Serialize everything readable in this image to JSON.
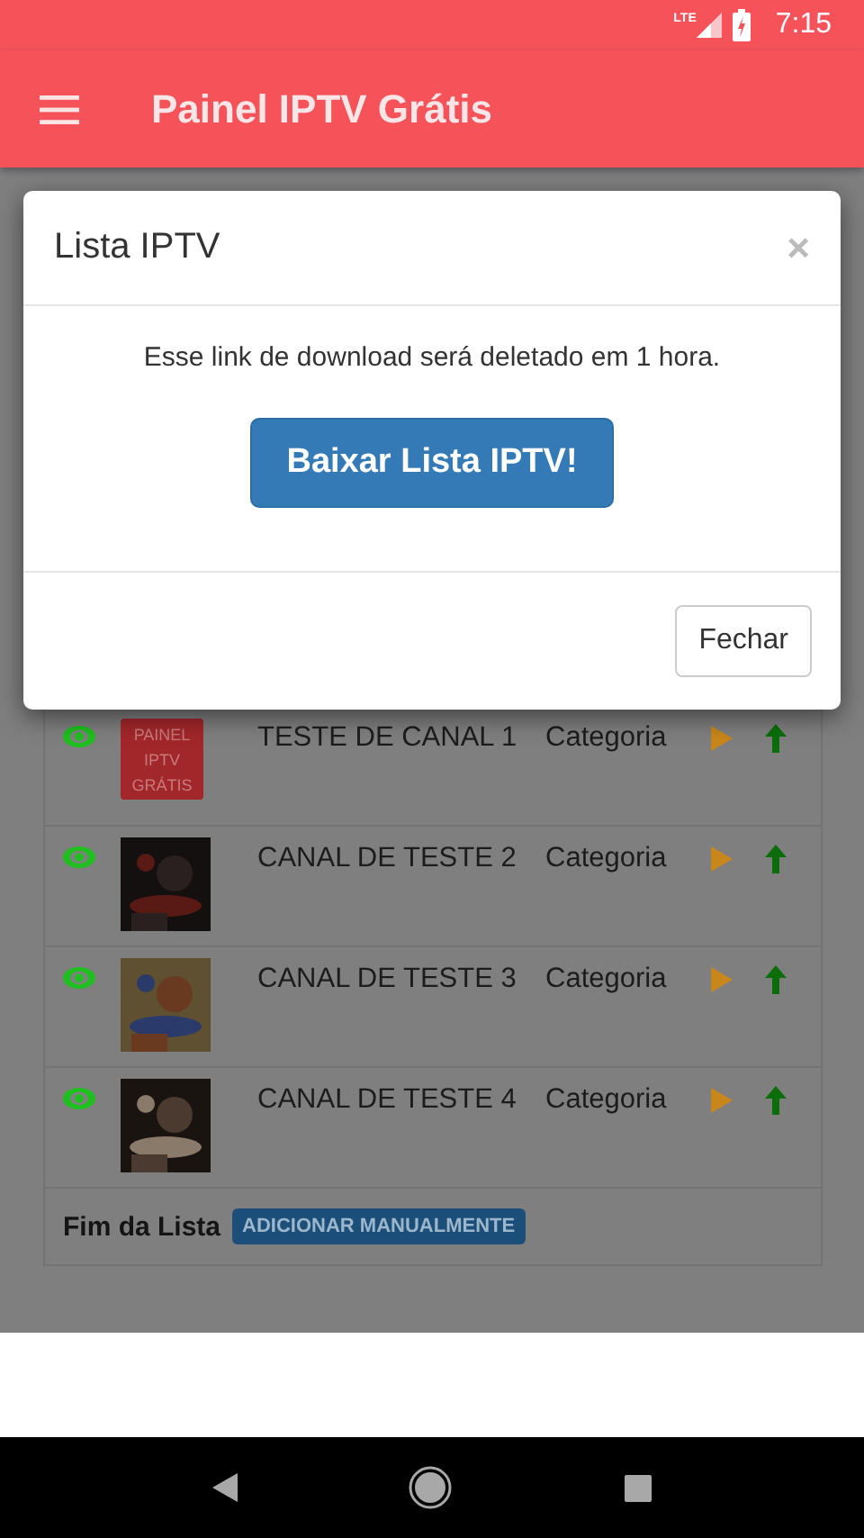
{
  "status_bar": {
    "network": "LTE",
    "time": "7:15"
  },
  "app_bar": {
    "title": "Painel IPTV Grátis"
  },
  "channels": [
    {
      "kind": "logo",
      "logo_text": "PAINEL IPTV GRÁTIS",
      "name": "TESTE DE CANAL 1",
      "category": "Categoria"
    },
    {
      "kind": "picture",
      "name": "CANAL DE TESTE 2",
      "category": "Categoria"
    },
    {
      "kind": "picture",
      "name": "CANAL DE TESTE 3",
      "category": "Categoria"
    },
    {
      "kind": "picture",
      "name": "CANAL DE TESTE 4",
      "category": "Categoria"
    }
  ],
  "list_footer": {
    "label": "Fim da Lista",
    "button": "ADICIONAR MANUALMENTE"
  },
  "dialog": {
    "title": "Lista IPTV",
    "close": "×",
    "message": "Esse link de download será deletado em 1 hora.",
    "primary_button": "Baixar Lista IPTV!",
    "secondary_button": "Fechar"
  }
}
